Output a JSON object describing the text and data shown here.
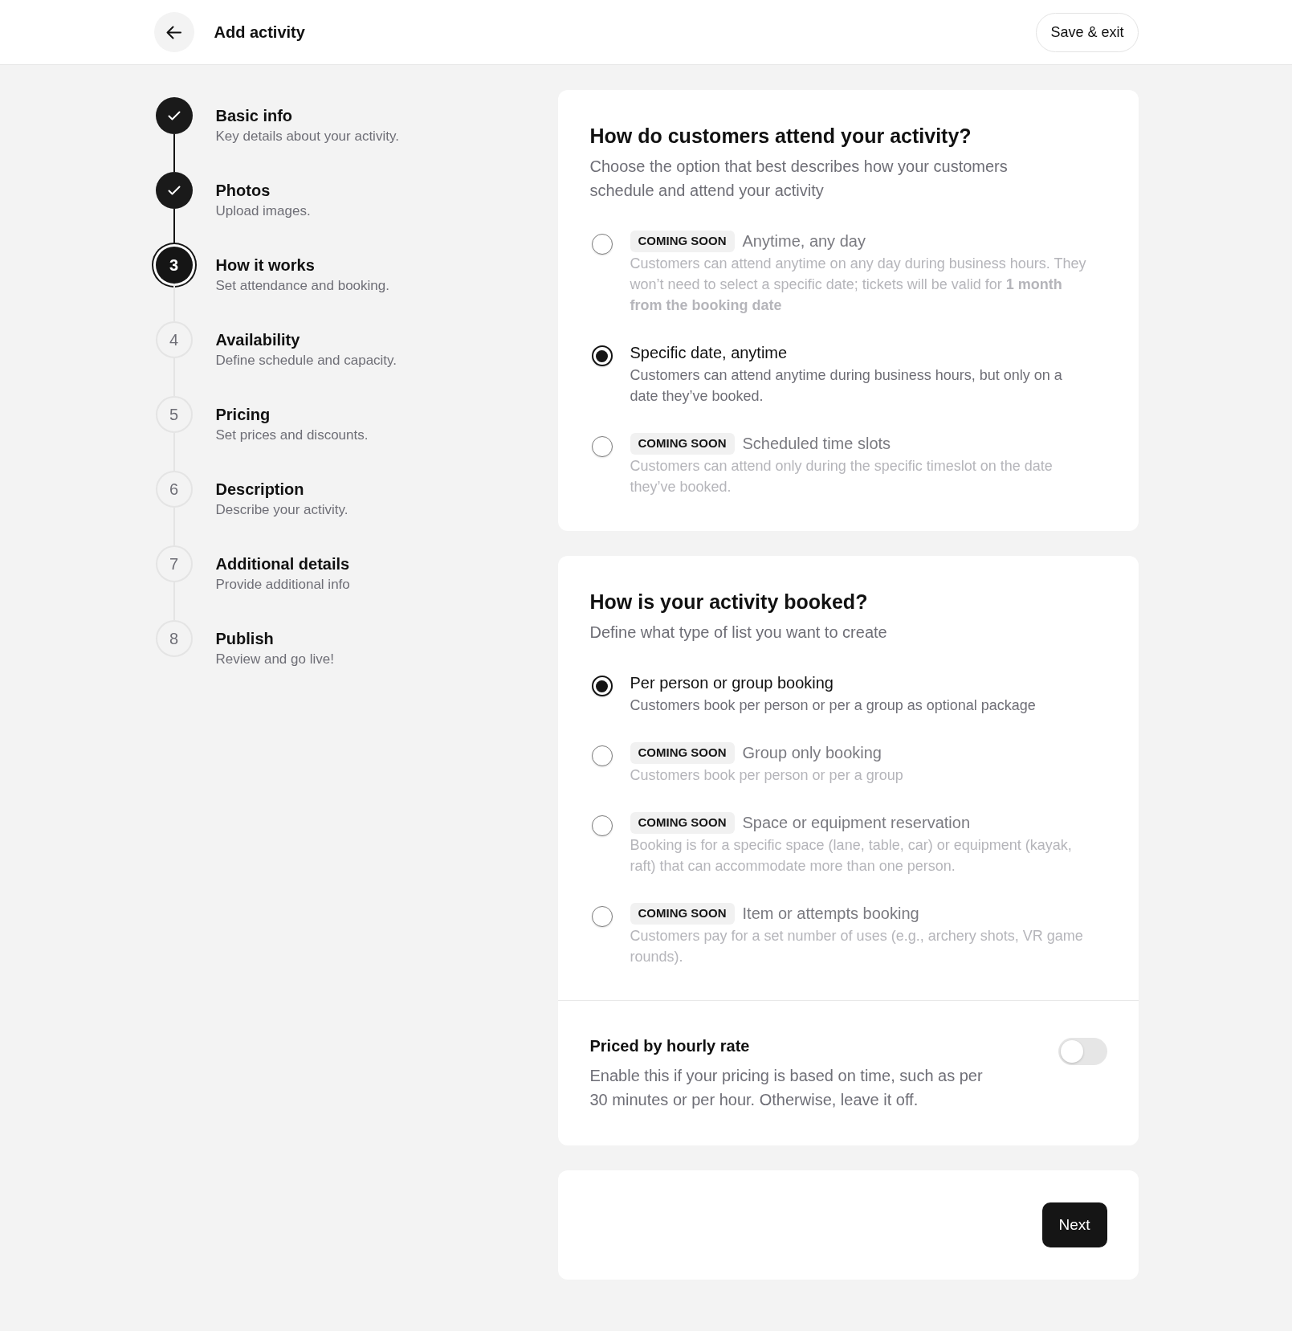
{
  "header": {
    "title": "Add activity",
    "save_button": "Save & exit"
  },
  "steps": [
    {
      "title": "Basic info",
      "description": "Key details about your activity.",
      "completed": true,
      "selected": false
    },
    {
      "title": "Photos",
      "description": "Upload images.",
      "completed": true,
      "selected": false
    },
    {
      "number": "3",
      "title": "How it works",
      "description": "Set attendance and booking.",
      "completed": false,
      "selected": true
    },
    {
      "number": "4",
      "title": "Availability",
      "description": "Define schedule and capacity.",
      "completed": false,
      "selected": false
    },
    {
      "number": "5",
      "title": "Pricing",
      "description": "Set prices and discounts.",
      "completed": false,
      "selected": false
    },
    {
      "number": "6",
      "title": "Description",
      "description": "Describe your activity.",
      "completed": false,
      "selected": false
    },
    {
      "number": "7",
      "title": "Additional details",
      "description": "Provide additional info",
      "completed": false,
      "selected": false
    },
    {
      "number": "8",
      "title": "Publish",
      "description": "Review and go live!",
      "completed": false,
      "selected": false
    }
  ],
  "sections": [
    {
      "title": "How do customers attend your activity?",
      "subtitle": "Choose the option that best describes how your customers schedule and attend your activity",
      "options": [
        {
          "badge": "COMING SOON",
          "label": "Anytime, any day",
          "description": "Customers can attend anytime on any day during business hours. They won’t need to select a specific date; tickets will be valid for **1 month from the booking date**",
          "selected": false,
          "disabled": true
        },
        {
          "label": "Specific date, anytime",
          "description": "Customers can attend anytime during business hours, but only on a date they’ve booked.",
          "selected": true,
          "disabled": false
        },
        {
          "badge": "COMING SOON",
          "label": "Scheduled time slots",
          "description": "Customers can attend only during the specific timeslot on the date they’ve booked.",
          "selected": false,
          "disabled": true
        }
      ]
    },
    {
      "title": "How is your activity booked?",
      "subtitle": "Define what type of list you want to create",
      "options": [
        {
          "label": "Per person or group booking",
          "description": "Customers book per person or per a group as optional package",
          "selected": true,
          "disabled": false
        },
        {
          "badge": "COMING SOON",
          "label": "Group only booking",
          "description": "Customers book per person or per a group",
          "selected": false,
          "disabled": true
        },
        {
          "badge": "COMING SOON",
          "label": "Space or equipment reservation",
          "description": "Booking is for a specific space (lane, table, car) or equipment (kayak, raft) that can accommodate more than one person.",
          "selected": false,
          "disabled": true
        },
        {
          "badge": "COMING SOON",
          "label": "Item or attempts booking",
          "description": "Customers pay for a set number of uses (e.g., archery shots, VR game rounds).",
          "selected": false,
          "disabled": true
        }
      ],
      "setting": {
        "title": "Priced by hourly rate",
        "description": "Enable this if your pricing is based on time, such as per 30 minutes or per hour. Otherwise, leave it off.",
        "on": false
      }
    }
  ],
  "footer": {
    "next_button": "Next"
  }
}
